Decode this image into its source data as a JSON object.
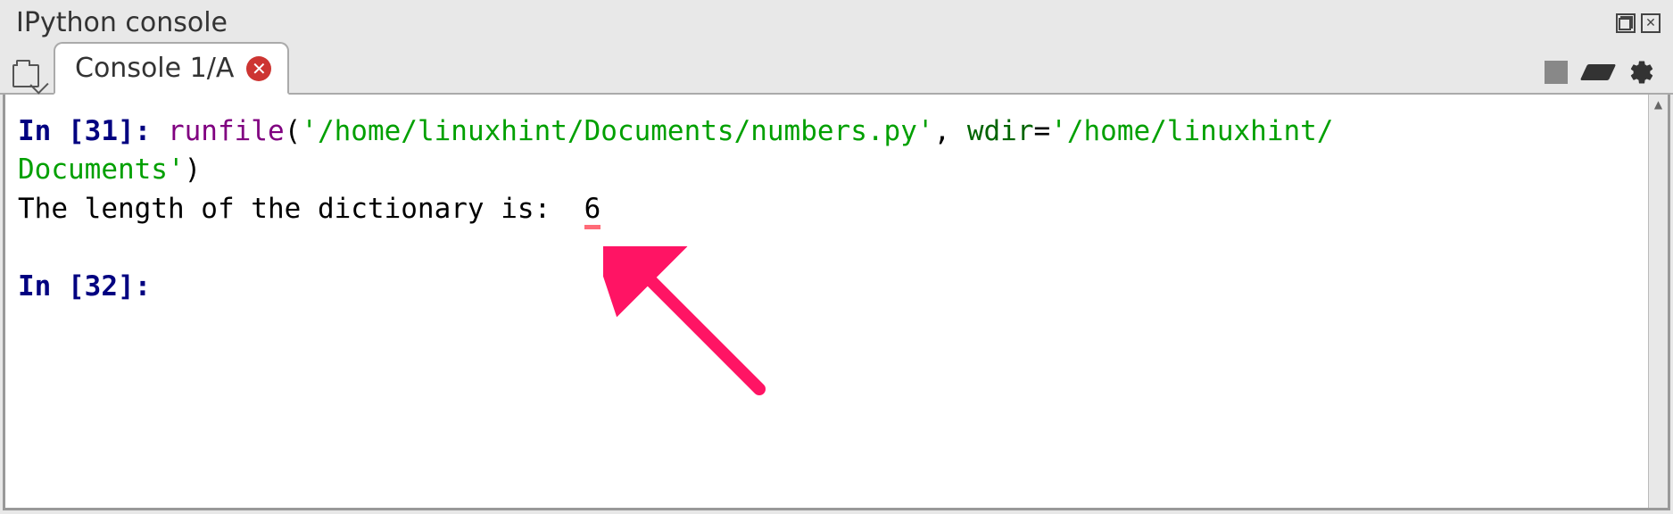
{
  "panel": {
    "title": "IPython console"
  },
  "tab": {
    "label": "Console 1/A"
  },
  "console": {
    "in_prefix1": "In [",
    "in_num1": "31",
    "in_suffix1": "]: ",
    "func_call": "runfile",
    "paren_open": "(",
    "path_str": "'/home/linuxhint/Documents/numbers.py'",
    "comma": ", ",
    "wdir_kw": "wdir",
    "eq": "=",
    "wdir_val1": "'/home/linuxhint/",
    "wdir_val2": "Documents'",
    "paren_close": ")",
    "output_text": "The length of the dictionary is:  ",
    "output_number": "6",
    "in_prefix2": "In [",
    "in_num2": "32",
    "in_suffix2": "]: "
  }
}
